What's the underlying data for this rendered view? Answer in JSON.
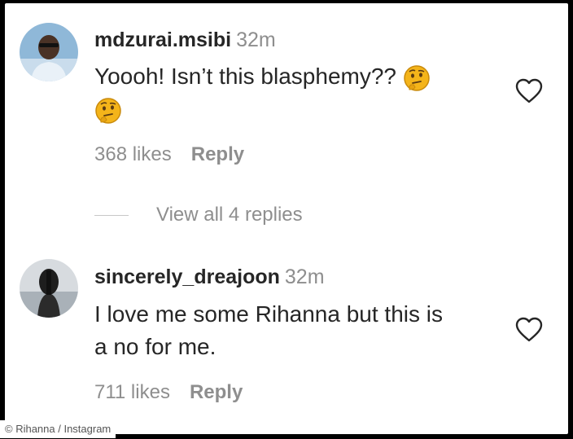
{
  "comments": [
    {
      "username": "mdzurai.msibi",
      "time": "32m",
      "text_line1": "Yoooh! Isn’t this blasphemy??",
      "emoji": "thinking-face-icon",
      "likes": "368 likes",
      "reply": "Reply"
    },
    {
      "username": "sincerely_dreajoon",
      "time": "32m",
      "text_line1": "I love me some Rihanna but this is",
      "text_line2": "a no for me.",
      "likes": "711 likes",
      "reply": "Reply"
    }
  ],
  "view_replies": "View all 4 replies",
  "credit": "© Rihanna / Instagram",
  "icons": {
    "like": "heart-outline-icon",
    "emoji": "thinking-face-icon"
  },
  "colors": {
    "primary_text": "#262626",
    "secondary_text": "#8e8e8e",
    "emoji_yellow": "#f4b41a"
  }
}
